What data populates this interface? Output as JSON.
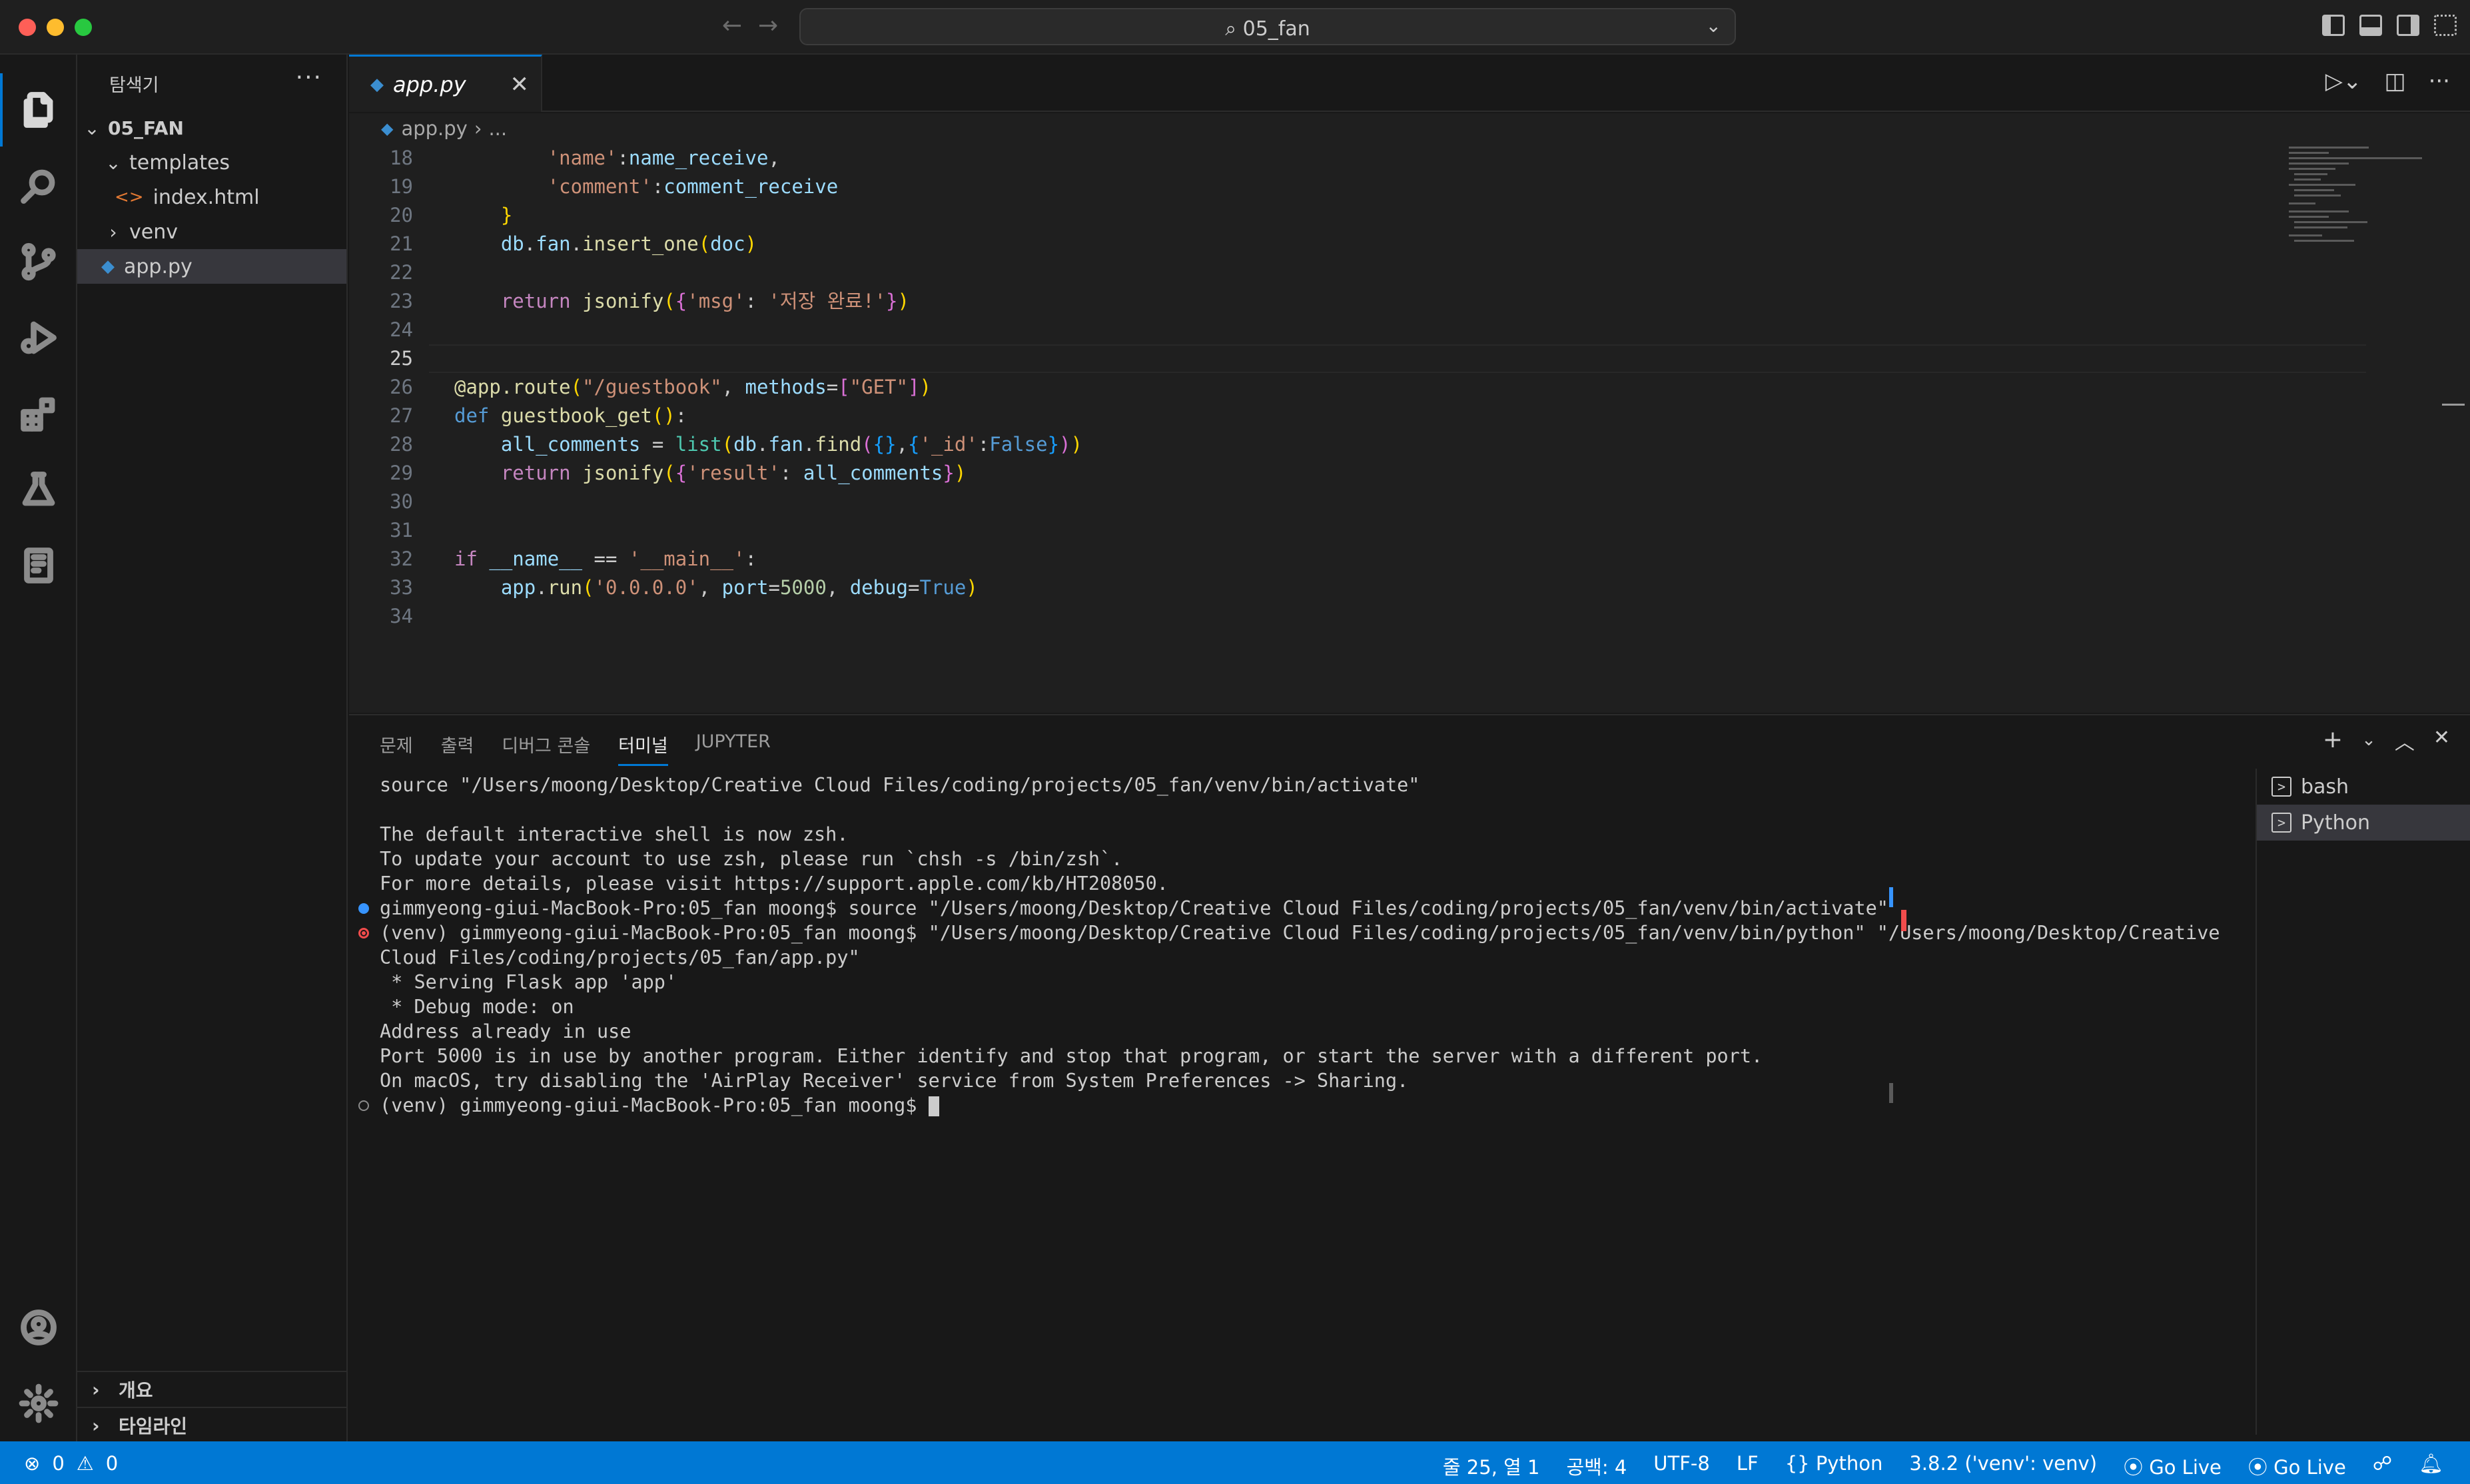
{
  "window": {
    "title": "05_fan"
  },
  "sidebar": {
    "title": "탐색기",
    "root": "05_FAN",
    "tree": [
      {
        "label": "templates",
        "type": "folder",
        "expanded": true
      },
      {
        "label": "index.html",
        "type": "file-html"
      },
      {
        "label": "venv",
        "type": "folder",
        "expanded": false
      },
      {
        "label": "app.py",
        "type": "file-py",
        "selected": true
      }
    ],
    "sections": [
      "개요",
      "타임라인"
    ]
  },
  "editor": {
    "tab_label": "app.py",
    "breadcrumb": [
      "app.py",
      "..."
    ],
    "current_line": "25",
    "lines": [
      {
        "n": "18",
        "text": "        'name':name_receive,"
      },
      {
        "n": "19",
        "text": "        'comment':comment_receive"
      },
      {
        "n": "20",
        "text": "    }"
      },
      {
        "n": "21",
        "text": "    db.fan.insert_one(doc)"
      },
      {
        "n": "22",
        "text": ""
      },
      {
        "n": "23",
        "text": "    return jsonify({'msg': '저장 완료!'})"
      },
      {
        "n": "24",
        "text": ""
      },
      {
        "n": "25",
        "text": ""
      },
      {
        "n": "26",
        "text": "@app.route(\"/guestbook\", methods=[\"GET\"])"
      },
      {
        "n": "27",
        "text": "def guestbook_get():"
      },
      {
        "n": "28",
        "text": "    all_comments = list(db.fan.find({},{'_id':False}))"
      },
      {
        "n": "29",
        "text": "    return jsonify({'result': all_comments})"
      },
      {
        "n": "30",
        "text": ""
      },
      {
        "n": "31",
        "text": ""
      },
      {
        "n": "32",
        "text": "if __name__ == '__main__':"
      },
      {
        "n": "33",
        "text": "    app.run('0.0.0.0', port=5000, debug=True)"
      },
      {
        "n": "34",
        "text": ""
      }
    ]
  },
  "panel": {
    "tabs": [
      "문제",
      "출력",
      "디버그 콘솔",
      "터미널",
      "JUPYTER"
    ],
    "active_tab": "터미널",
    "terminal_lines": [
      {
        "text": "source \"/Users/moong/Desktop/Creative Cloud Files/coding/projects/05_fan/venv/bin/activate\"",
        "deco": ""
      },
      {
        "text": "",
        "deco": ""
      },
      {
        "text": "The default interactive shell is now zsh.",
        "deco": ""
      },
      {
        "text": "To update your account to use zsh, please run `chsh -s /bin/zsh`.",
        "deco": ""
      },
      {
        "text": "For more details, please visit https://support.apple.com/kb/HT208050.",
        "deco": ""
      },
      {
        "text": "gimmyeong-giui-MacBook-Pro:05_fan moong$ source \"/Users/moong/Desktop/Creative Cloud Files/coding/projects/05_fan/venv/bin/activate\"",
        "deco": "blue"
      },
      {
        "text": "(venv) gimmyeong-giui-MacBook-Pro:05_fan moong$ \"/Users/moong/Desktop/Creative Cloud Files/coding/projects/05_fan/venv/bin/python\" \"/Users/moong/Desktop/Creative",
        "deco": "err"
      },
      {
        "text": "Cloud Files/coding/projects/05_fan/app.py\"",
        "deco": ""
      },
      {
        "text": " * Serving Flask app 'app'",
        "deco": ""
      },
      {
        "text": " * Debug mode: on",
        "deco": ""
      },
      {
        "text": "Address already in use",
        "deco": ""
      },
      {
        "text": "Port 5000 is in use by another program. Either identify and stop that program, or start the server with a different port.",
        "deco": ""
      },
      {
        "text": "On macOS, try disabling the 'AirPlay Receiver' service from System Preferences -> Sharing.",
        "deco": ""
      },
      {
        "text": "(venv) gimmyeong-giui-MacBook-Pro:05_fan moong$ ",
        "deco": "empty",
        "cursor": true
      }
    ],
    "terminals": [
      {
        "label": "bash",
        "active": false
      },
      {
        "label": "Python",
        "active": true
      }
    ]
  },
  "statusbar": {
    "errors": "0",
    "warnings": "0",
    "position": "줄 25, 열 1",
    "spaces": "공백: 4",
    "encoding": "UTF-8",
    "eol": "LF",
    "language": "Python",
    "interpreter": "3.8.2 ('venv': venv)",
    "go_live_1": "Go Live",
    "go_live_2": "Go Live"
  },
  "colors": {
    "accent": "#0078d4",
    "editor_bg": "#1f1f1f",
    "sidebar_bg": "#181818",
    "selection": "#37373d",
    "error": "#f14c4c"
  }
}
